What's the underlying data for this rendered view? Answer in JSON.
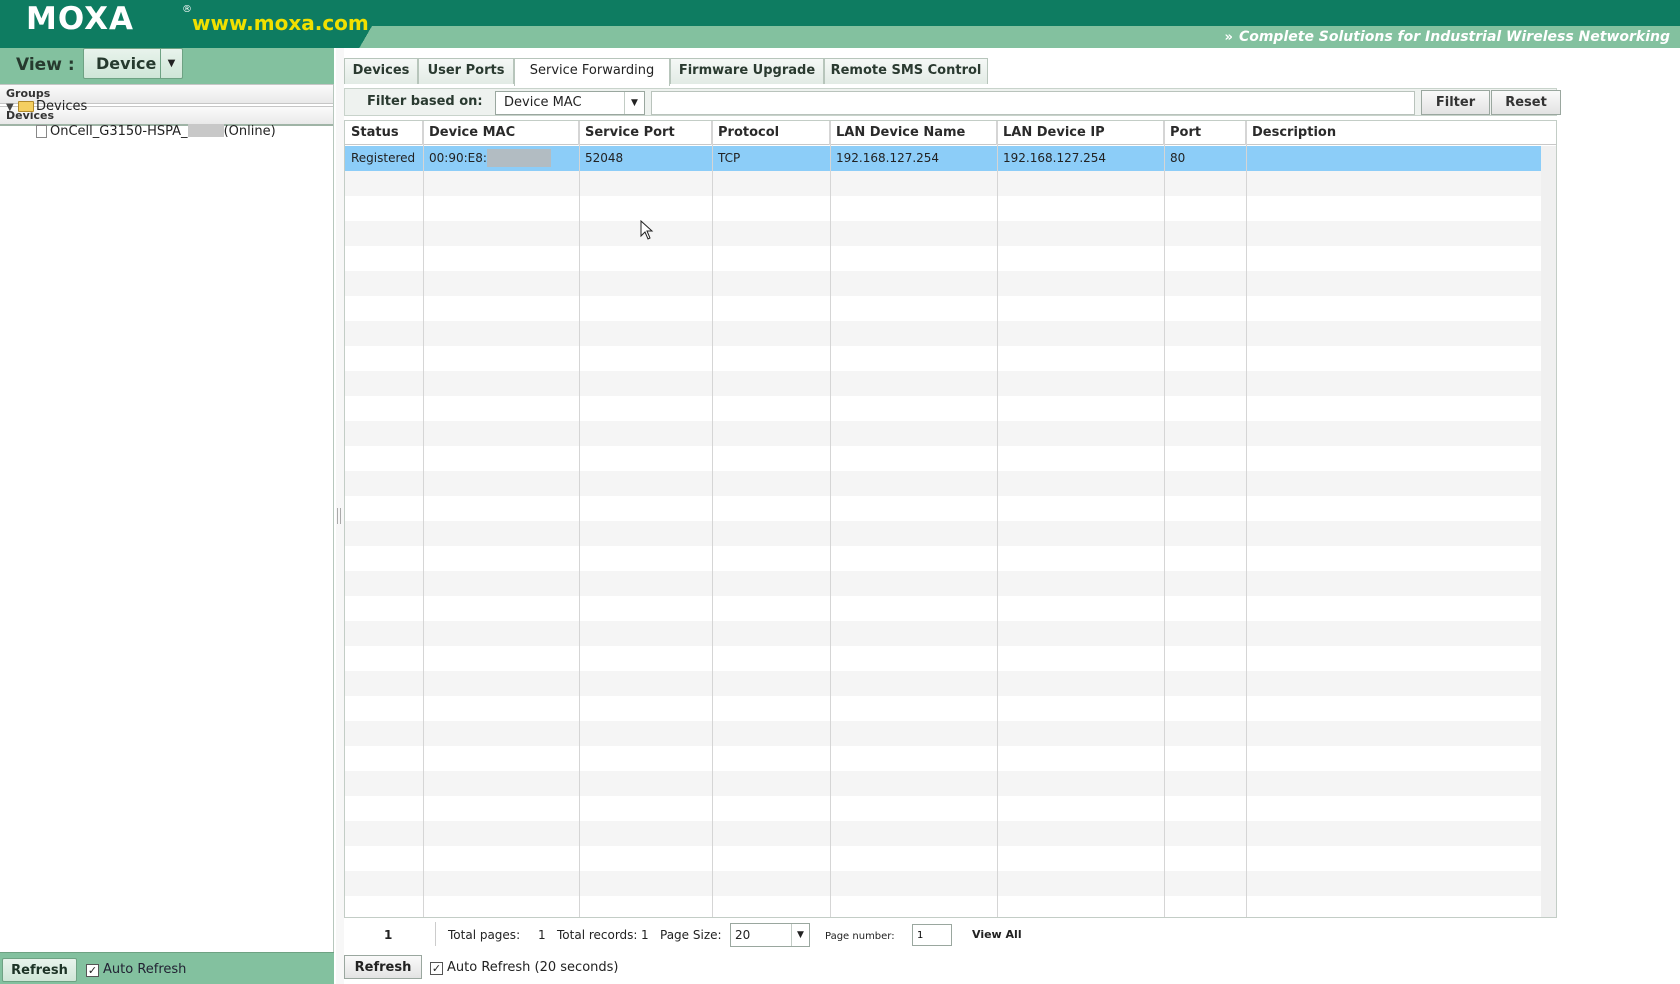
{
  "header": {
    "logo_text": "MOXA",
    "logo_reg": "®",
    "logo_url": "www.moxa.com",
    "tagline_icon": "»",
    "tagline": "Complete Solutions for Industrial Wireless Networking"
  },
  "sidebar": {
    "view_label": "View :",
    "view_value": "Device",
    "accordion": {
      "groups": "Groups",
      "devices": "Devices"
    },
    "tree": {
      "root": "Devices",
      "child_prefix": "OnCell_G3150-HSPA_",
      "child_suffix": "(Online)"
    },
    "refresh_label": "Refresh",
    "auto_refresh_label": "Auto Refresh",
    "auto_refresh_checked": true
  },
  "tabs": [
    {
      "label": "Devices",
      "active": false
    },
    {
      "label": "User Ports",
      "active": false
    },
    {
      "label": "Service Forwarding",
      "active": true
    },
    {
      "label": "Firmware Upgrade",
      "active": false
    },
    {
      "label": "Remote SMS Control",
      "active": false
    }
  ],
  "filter": {
    "label": "Filter based on:",
    "field": "Device MAC",
    "value": "",
    "filter_label": "Filter",
    "reset_label": "Reset"
  },
  "grid": {
    "columns": [
      "Status",
      "Device MAC",
      "Service Port",
      "Protocol",
      "LAN Device Name",
      "LAN Device IP",
      "Port",
      "Description"
    ],
    "rows": [
      {
        "status": "Registered",
        "mac": "00:90:E8:",
        "service_port": "52048",
        "protocol": "TCP",
        "lan_name": "192.168.127.254",
        "lan_ip": "192.168.127.254",
        "port": "80",
        "description": "",
        "selected": true
      }
    ]
  },
  "pager": {
    "current_page": "1",
    "total_pages_label": "Total pages:",
    "total_pages": "1",
    "total_records_label": "Total records:",
    "total_records": "1",
    "page_size_label": "Page Size:",
    "page_size": "20",
    "page_number_label": "Page number:",
    "page_number": "1",
    "view_all_label": "View All"
  },
  "footer": {
    "refresh_label": "Refresh",
    "auto_refresh_label": "Auto Refresh (20 seconds)",
    "auto_refresh_checked": true
  },
  "colors": {
    "header_dark": "#0e7c61",
    "header_light": "#83c19f",
    "logo_url": "#f0e000",
    "selected_row": "#8ccdf8"
  }
}
